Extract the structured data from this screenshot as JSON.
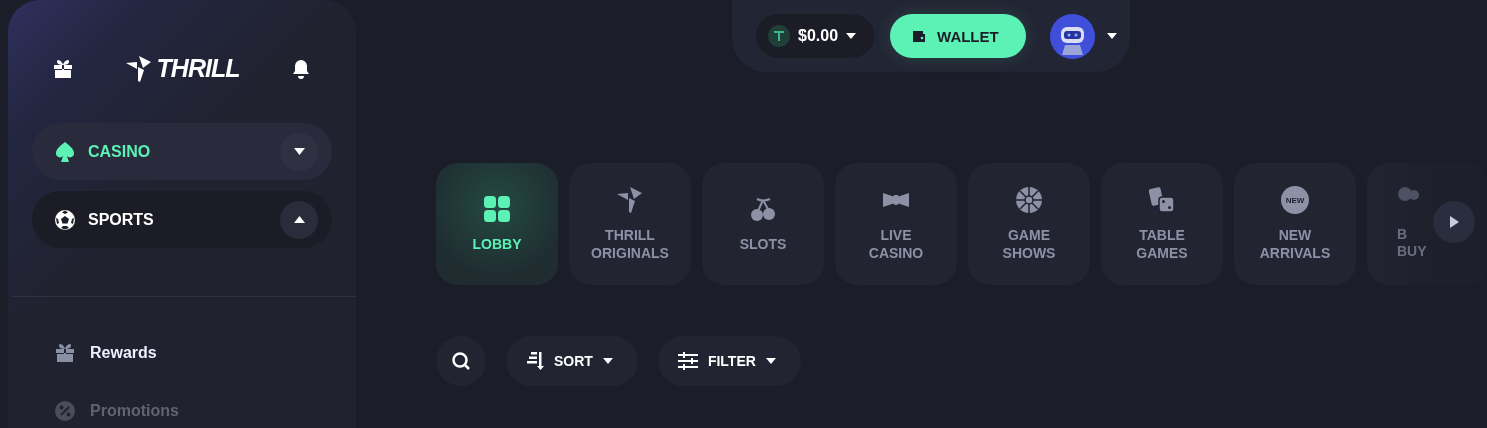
{
  "sidebar": {
    "logo": "THRILL",
    "nav": [
      {
        "label": "CASINO",
        "selected": true,
        "expanded": false
      },
      {
        "label": "SPORTS",
        "selected": false,
        "expanded": true
      }
    ],
    "links": [
      {
        "label": "Rewards"
      },
      {
        "label": "Promotions"
      }
    ]
  },
  "topbar": {
    "balance": "$0.00",
    "wallet": "WALLET"
  },
  "categories": [
    {
      "label": "LOBBY",
      "selected": true
    },
    {
      "label": "THRILL\nORIGINALS",
      "selected": false
    },
    {
      "label": "SLOTS",
      "selected": false
    },
    {
      "label": "LIVE\nCASINO",
      "selected": false
    },
    {
      "label": "GAME\nSHOWS",
      "selected": false
    },
    {
      "label": "TABLE\nGAMES",
      "selected": false
    },
    {
      "label": "NEW\nARRIVALS",
      "badge": "NEW",
      "selected": false
    },
    {
      "label": "B\nBUY",
      "selected": false,
      "kind": "partial"
    }
  ],
  "toolbar": {
    "sort": "SORT",
    "filter": "FILTER"
  }
}
